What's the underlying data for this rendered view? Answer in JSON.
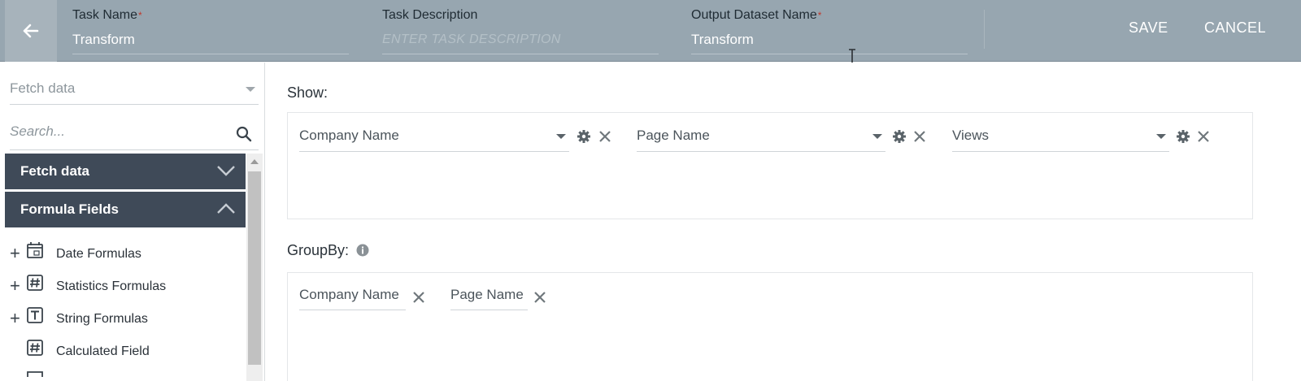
{
  "header": {
    "task_name_label": "Task Name",
    "task_name_value": "Transform",
    "task_description_label": "Task Description",
    "task_description_placeholder": "ENTER TASK DESCRIPTION",
    "output_dataset_label": "Output Dataset Name",
    "output_dataset_value": "Transform",
    "required_mark": "*",
    "save_label": "SAVE",
    "cancel_label": "CANCEL"
  },
  "sidebar": {
    "source_select": "Fetch data",
    "search_placeholder": "Search...",
    "sections": [
      {
        "label": "Fetch data",
        "expanded": false
      },
      {
        "label": "Formula Fields",
        "expanded": true
      }
    ],
    "formula_items": [
      {
        "label": "Date Formulas",
        "icon": "calendar-icon",
        "expandable": true
      },
      {
        "label": "Statistics Formulas",
        "icon": "hash-icon",
        "expandable": true
      },
      {
        "label": "String Formulas",
        "icon": "text-icon",
        "expandable": true
      },
      {
        "label": "Calculated Field",
        "icon": "hash-icon",
        "expandable": false
      }
    ]
  },
  "main": {
    "show_title": "Show:",
    "show_fields": [
      "Company Name",
      "Page Name",
      "Views"
    ],
    "groupby_title": "GroupBy:",
    "groupby_fields": [
      "Company Name",
      "Page Name"
    ]
  },
  "colors": {
    "header_bg": "#97a6b0",
    "accordion_bg": "#3f4a58",
    "required": "#c0392b"
  }
}
